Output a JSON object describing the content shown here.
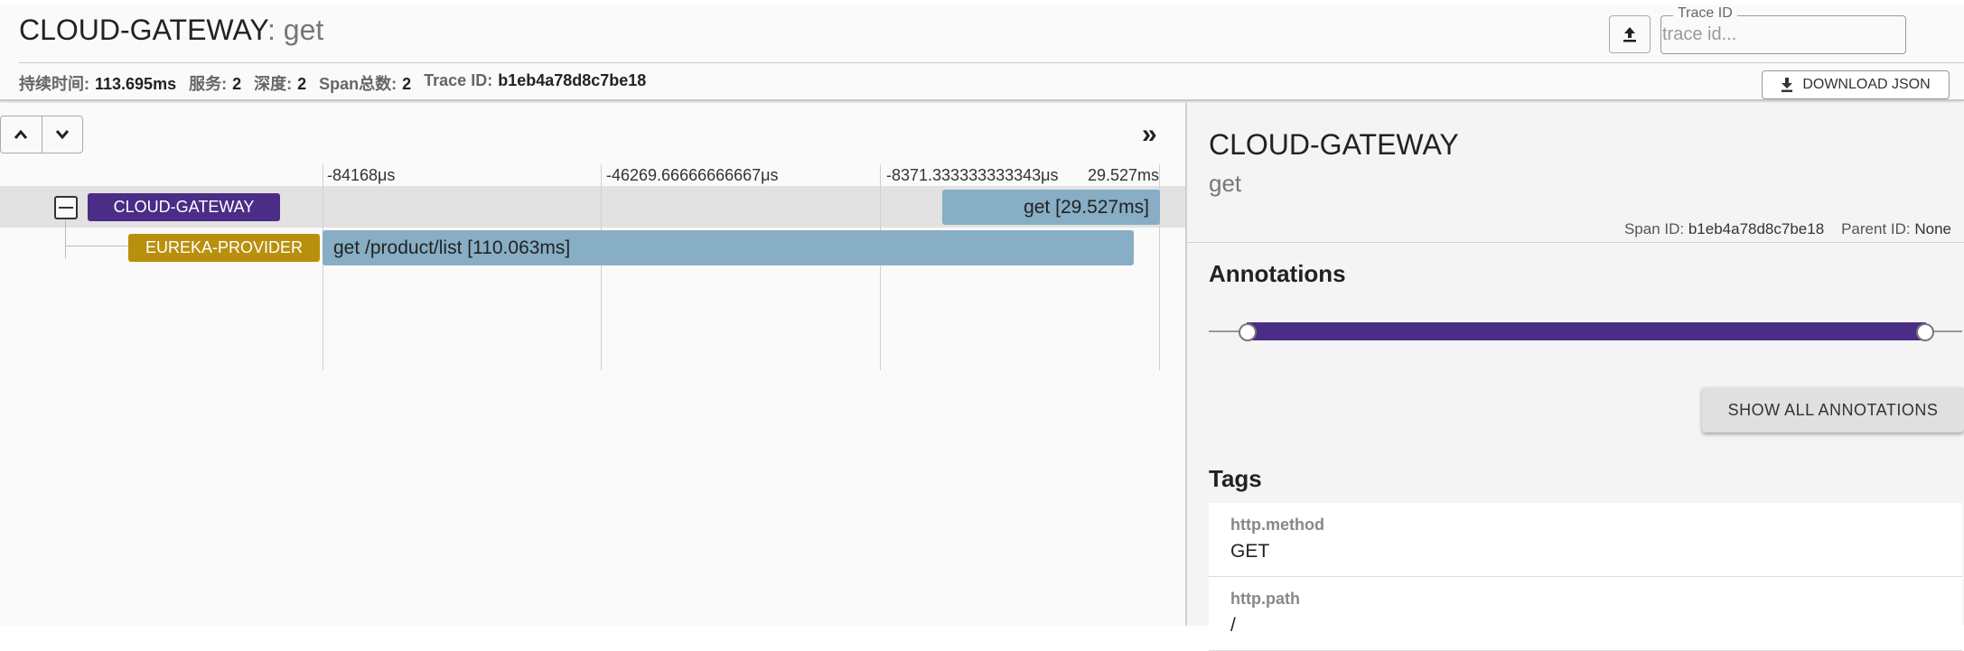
{
  "header": {
    "service": "CLOUD-GATEWAY",
    "separator": ": ",
    "operation": "get",
    "trace_id_legend": "Trace ID",
    "trace_id_placeholder": "trace id...",
    "download_label": "DOWNLOAD JSON",
    "stats": [
      {
        "label": "持续时间:",
        "value": "113.695ms"
      },
      {
        "label": "服务:",
        "value": "2"
      },
      {
        "label": "深度:",
        "value": "2"
      },
      {
        "label": "Span总数:",
        "value": "2"
      },
      {
        "label": "Trace ID:",
        "value": "b1eb4a78d8c7be18"
      }
    ]
  },
  "timeline": {
    "ticks": [
      "-84168μs",
      "-46269.66666666667μs",
      "-8371.333333333343μs",
      "29.527ms"
    ],
    "rows": [
      {
        "service": "CLOUD-GATEWAY",
        "color": "#4b2c87",
        "span_label": "get [29.527ms]"
      },
      {
        "service": "EUREKA-PROVIDER",
        "color": "#b8900d",
        "span_label": "get /product/list [110.063ms]"
      }
    ]
  },
  "detail": {
    "service": "CLOUD-GATEWAY",
    "operation": "get",
    "span_id_label": "Span ID:",
    "span_id": "b1eb4a78d8c7be18",
    "parent_id_label": "Parent ID:",
    "parent_id": "None",
    "annotations_title": "Annotations",
    "annotation_color": "#4b2c87",
    "show_all_label": "SHOW ALL ANNOTATIONS",
    "tags_title": "Tags",
    "tags": [
      {
        "key": "http.method",
        "value": "GET"
      },
      {
        "key": "http.path",
        "value": "/"
      }
    ]
  }
}
